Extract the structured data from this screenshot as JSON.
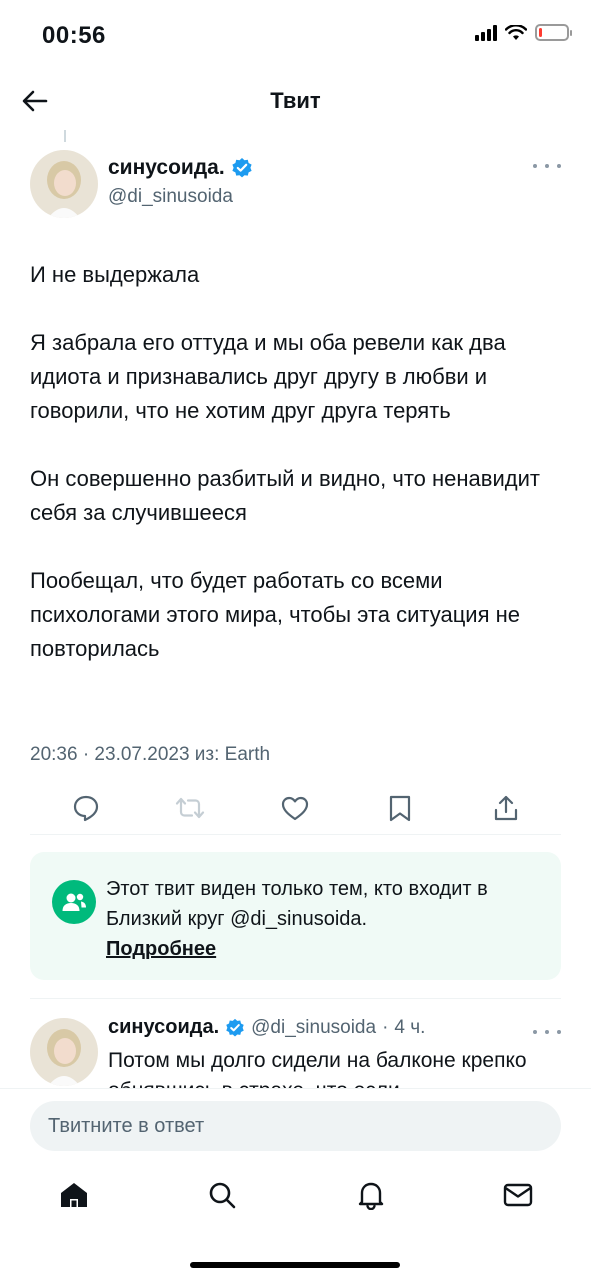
{
  "status_bar": {
    "time": "00:56",
    "battery_level": 0.12,
    "battery_color": "#ff3b30"
  },
  "nav": {
    "title": "Твит",
    "back_icon": "arrow-left-icon"
  },
  "tweet": {
    "author_name": "синусоида.",
    "verified": true,
    "handle": "@di_sinusoida",
    "paragraphs": [
      "И не выдержала",
      "Я забрала его оттуда и мы оба ревели как два идиота и признавались друг другу в любви и говорили, что не хотим друг друга терять",
      "Он совершенно разбитый и видно, что ненавидит себя за случившееся",
      "Пообещал, что будет работать со всеми психологами этого мира, чтобы эта ситуация не повторилась"
    ],
    "meta": "20:36 · 23.07.2023 из: Earth",
    "actions": [
      "reply-icon",
      "retweet-icon",
      "like-icon",
      "bookmark-icon",
      "share-icon"
    ]
  },
  "circle_notice": {
    "text": "Этот твит виден только тем, кто входит в Близкий круг @di_sinusoida.",
    "link": "Подробнее",
    "accent": "#00ba7c"
  },
  "reply": {
    "author_name": "синусоида.",
    "verified": true,
    "handle": "@di_sinusoida",
    "separator": "·",
    "time": "4 ч.",
    "text": "Потом мы долго сидели на балконе крепко обнявшись в страхе, что если"
  },
  "composer": {
    "placeholder": "Твитните в ответ"
  },
  "tabbar": [
    "home-icon",
    "search-icon",
    "notifications-icon",
    "messages-icon"
  ],
  "colors": {
    "verified": "#1d9bf0",
    "secondary_text": "#536471"
  }
}
